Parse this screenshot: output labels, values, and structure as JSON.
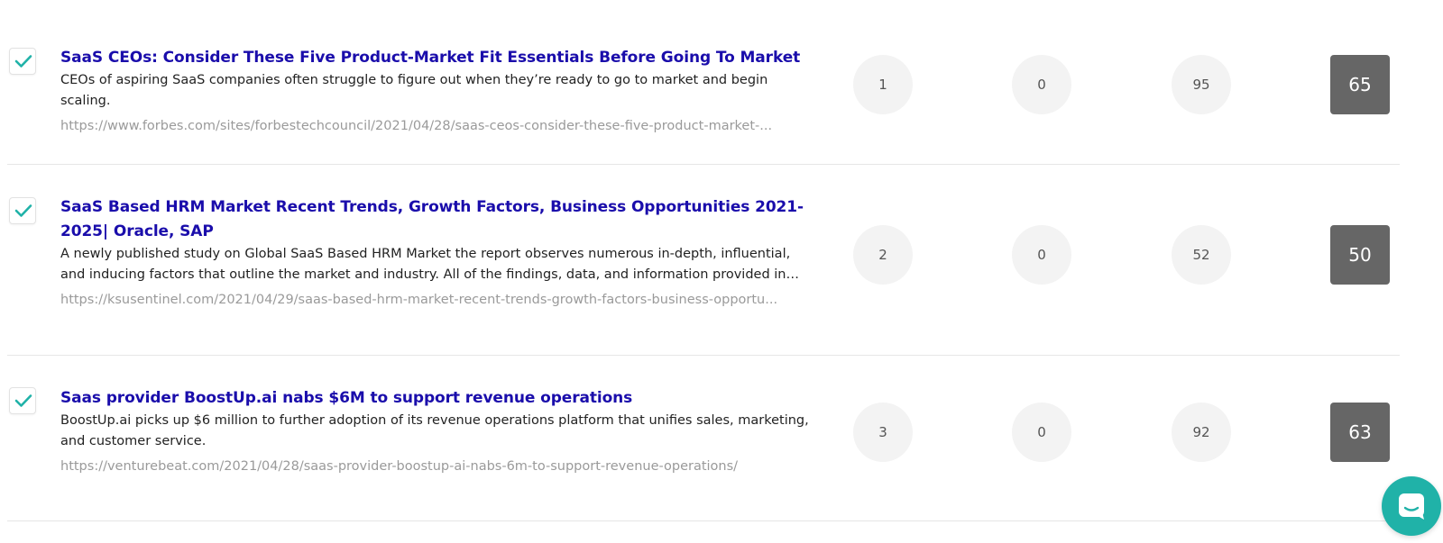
{
  "colors": {
    "title_link": "#1a0dab",
    "check_teal": "#20b2a8",
    "score_bg": "#666666",
    "circle_bg": "#f3f3f3",
    "url_gray": "#9a9a9a"
  },
  "rows": [
    {
      "checked": true,
      "title": "SaaS CEOs: Consider These Five Product-Market Fit Essentials Before Going To Market",
      "description": "CEOs of aspiring SaaS companies often struggle to figure out when they’re ready to go to market and begin scaling.",
      "url": "https://www.forbes.com/sites/forbestechcouncil/2021/04/28/saas-ceos-consider-these-five-product-market-...",
      "metric_1": "1",
      "metric_2": "0",
      "metric_3": "95",
      "score": "65"
    },
    {
      "checked": true,
      "title": "SaaS Based HRM Market Recent Trends, Growth Factors, Business Opportunities 2021-2025| Oracle, SAP",
      "description": "A newly published study on Global SaaS Based HRM Market the report observes numerous in-depth, influential, and inducing factors that outline the market and industry. All of the findings, data, and information provided in the...",
      "url": "https://ksusentinel.com/2021/04/29/saas-based-hrm-market-recent-trends-growth-factors-business-opportu...",
      "metric_1": "2",
      "metric_2": "0",
      "metric_3": "52",
      "score": "50"
    },
    {
      "checked": true,
      "title": "Saas provider BoostUp.ai nabs $6M to support revenue operations",
      "description": "BoostUp.ai picks up $6 million to further adoption of its revenue operations platform that unifies sales, marketing, and customer service.",
      "url": "https://venturebeat.com/2021/04/28/saas-provider-boostup-ai-nabs-6m-to-support-revenue-operations/",
      "metric_1": "3",
      "metric_2": "0",
      "metric_3": "92",
      "score": "63"
    }
  ],
  "chat": {
    "icon": "chat-bubble-icon"
  }
}
